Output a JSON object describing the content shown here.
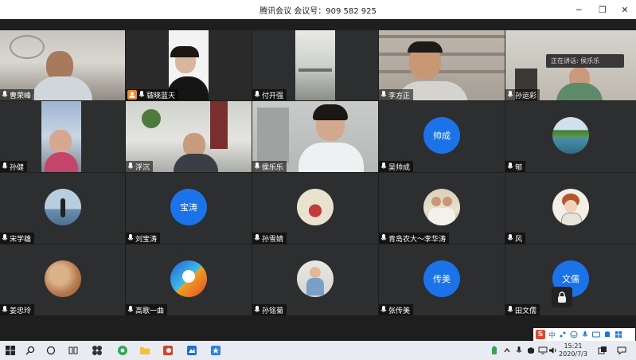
{
  "window": {
    "title": "腾讯会议  会议号：909 582 925",
    "minimize": "─",
    "restore": "❐",
    "close": "✕"
  },
  "speaking_indicator": "正在讲话: 侯乐乐",
  "participants": [
    {
      "name": "曹荣峰",
      "type": "video"
    },
    {
      "name": "皲晓蓝天",
      "type": "video"
    },
    {
      "name": "付开强",
      "type": "video"
    },
    {
      "name": "李方正",
      "type": "video"
    },
    {
      "name": "孙运彩",
      "type": "video"
    },
    {
      "name": "孙健",
      "type": "video"
    },
    {
      "name": "浮沉",
      "type": "video"
    },
    {
      "name": "侯乐乐",
      "type": "video",
      "active": true
    },
    {
      "name": "吴帅成",
      "type": "text-avatar",
      "avatar_text": "帅成"
    },
    {
      "name": "郇",
      "type": "photo-avatar"
    },
    {
      "name": "宋学雄",
      "type": "photo-avatar"
    },
    {
      "name": "刘宝涛",
      "type": "text-avatar",
      "avatar_text": "宝涛"
    },
    {
      "name": "孙雪婧",
      "type": "photo-avatar"
    },
    {
      "name": "青岛农大～李华涛",
      "type": "photo-avatar"
    },
    {
      "name": "风",
      "type": "photo-avatar"
    },
    {
      "name": "姜忠玲",
      "type": "photo-avatar"
    },
    {
      "name": "高歌一曲",
      "type": "photo-avatar"
    },
    {
      "name": "孙铭菊",
      "type": "photo-avatar"
    },
    {
      "name": "张传美",
      "type": "text-avatar",
      "avatar_text": "传美"
    },
    {
      "name": "田文儒",
      "type": "text-avatar",
      "avatar_text": "文儒"
    }
  ],
  "ime": {
    "logo": "S",
    "mode": "中"
  },
  "taskbar": {
    "time": "15:21",
    "date": "2020/7/3"
  },
  "colors": {
    "avatar_blue": "#1a73e8",
    "active_border": "#21c065",
    "tile_bg": "#2d2e30"
  }
}
